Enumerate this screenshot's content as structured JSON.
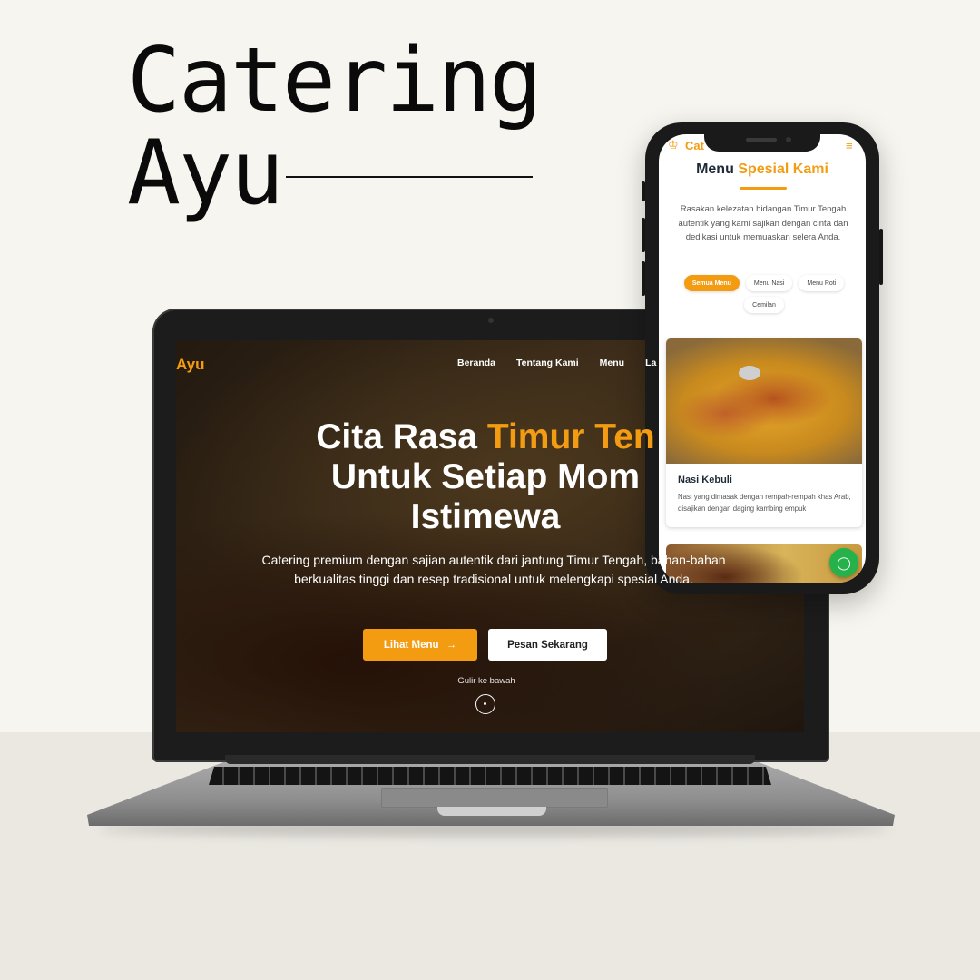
{
  "brand": {
    "line1": "Catering",
    "line2": "Ayu"
  },
  "laptop_site": {
    "logo": "Ayu",
    "nav": [
      "Beranda",
      "Tentang Kami",
      "Menu",
      "La"
    ],
    "hero": {
      "line1_plain": "Cita Rasa ",
      "line1_accent": "Timur Ten",
      "line2": "Untuk Setiap Mom",
      "line3": "Istimewa",
      "subtitle": "Catering premium dengan sajian autentik dari jantung Timur Tengah, bahan-bahan berkualitas tinggi dan resep tradisional untuk melengkapi spesial Anda."
    },
    "buttons": {
      "menu": "Lihat Menu",
      "menu_icon": "→",
      "order": "Pesan Sekarang"
    },
    "scroll_text": "Gulir ke bawah"
  },
  "phone_site": {
    "logo": "Cat",
    "logo_icon": "♔",
    "menu_icon": "≡",
    "section_title_plain": "Menu ",
    "section_title_accent": "Spesial Kami",
    "description": "Rasakan kelezatan hidangan Timur Tengah autentik yang kami sajikan dengan cinta dan dedikasi untuk memuaskan selera Anda.",
    "tabs": [
      "Semua Menu",
      "Menu Nasi",
      "Menu Roti",
      "Cemilan"
    ],
    "card": {
      "name": "Nasi Kebuli",
      "description": "Nasi yang dimasak dengan rempah-rempah khas Arab, disajikan dengan daging kambing empuk"
    },
    "whatsapp_icon": "◯"
  },
  "colors": {
    "accent": "#f39c12",
    "background": "#f6f5ef",
    "floor": "#ebe8e2",
    "dark_text": "#1e2a38"
  }
}
